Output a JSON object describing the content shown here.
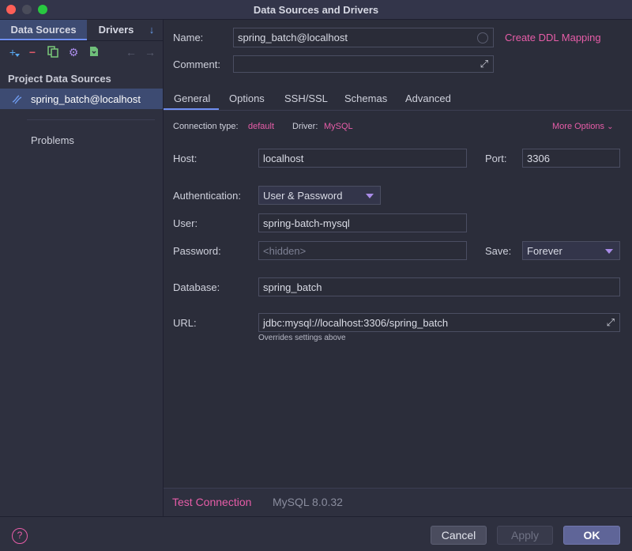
{
  "window": {
    "title": "Data Sources and Drivers"
  },
  "left_panel": {
    "tabs": {
      "data_sources": "Data Sources",
      "drivers": "Drivers"
    },
    "toolbar_icons": [
      "add-icon",
      "remove-icon",
      "copy-icon",
      "settings-icon",
      "import-icon",
      "back-arrow-icon",
      "forward-arrow-icon"
    ],
    "section_title": "Project Data Sources",
    "selected_item": "spring_batch@localhost",
    "problems_label": "Problems"
  },
  "header": {
    "name_label": "Name:",
    "name_value": "spring_batch@localhost",
    "create_ddl": "Create DDL Mapping",
    "comment_label": "Comment:",
    "comment_value": ""
  },
  "tabs": [
    "General",
    "Options",
    "SSH/SSL",
    "Schemas",
    "Advanced"
  ],
  "general": {
    "connection_type_label": "Connection type:",
    "connection_type_value": "default",
    "driver_label": "Driver:",
    "driver_value": "MySQL",
    "more_options": "More Options",
    "host_label": "Host:",
    "host_value": "localhost",
    "port_label": "Port:",
    "port_value": "3306",
    "auth_label": "Authentication:",
    "auth_value": "User & Password",
    "user_label": "User:",
    "user_value": "spring-batch-mysql",
    "password_label": "Password:",
    "password_placeholder": "<hidden>",
    "save_label": "Save:",
    "save_value": "Forever",
    "database_label": "Database:",
    "database_value": "spring_batch",
    "url_label": "URL:",
    "url_value": "jdbc:mysql://localhost:3306/spring_batch",
    "url_hint": "Overrides settings above"
  },
  "footer_panel": {
    "test_connection": "Test Connection",
    "version": "MySQL 8.0.32"
  },
  "buttons": {
    "cancel": "Cancel",
    "apply": "Apply",
    "ok": "OK"
  },
  "colors": {
    "accent_pink": "#e75da8",
    "selection_blue": "#3d4b72",
    "ok_button": "#5f6598",
    "background": "#2b2d3a"
  }
}
